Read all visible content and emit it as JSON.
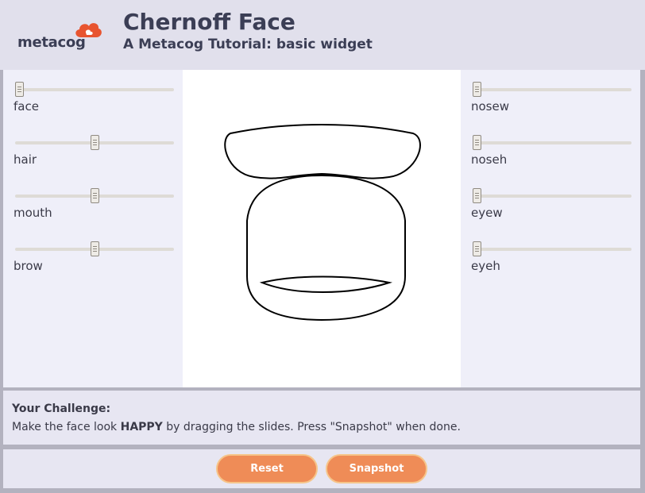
{
  "header": {
    "logo_text": "metacog",
    "title": "Chernoff Face",
    "subtitle": "A Metacog Tutorial: basic widget"
  },
  "sliders_left": [
    {
      "label": "face",
      "value": 0.0
    },
    {
      "label": "hair",
      "value": 0.5
    },
    {
      "label": "mouth",
      "value": 0.5
    },
    {
      "label": "brow",
      "value": 0.5
    }
  ],
  "sliders_right": [
    {
      "label": "nosew",
      "value": 0.0
    },
    {
      "label": "noseh",
      "value": 0.0
    },
    {
      "label": "eyew",
      "value": 0.0
    },
    {
      "label": "eyeh",
      "value": 0.0
    }
  ],
  "challenge": {
    "title": "Your Challenge:",
    "text_before": "Make the face look ",
    "text_emphasis": "HAPPY",
    "text_after": " by dragging the slides. Press \"Snapshot\" when done."
  },
  "buttons": {
    "reset": "Reset",
    "snapshot": "Snapshot"
  },
  "colors": {
    "accent": "#ef8c57",
    "header_bg": "#e1e0ec",
    "panel_bg": "#efeff9",
    "logo_orange": "#e8542f"
  }
}
